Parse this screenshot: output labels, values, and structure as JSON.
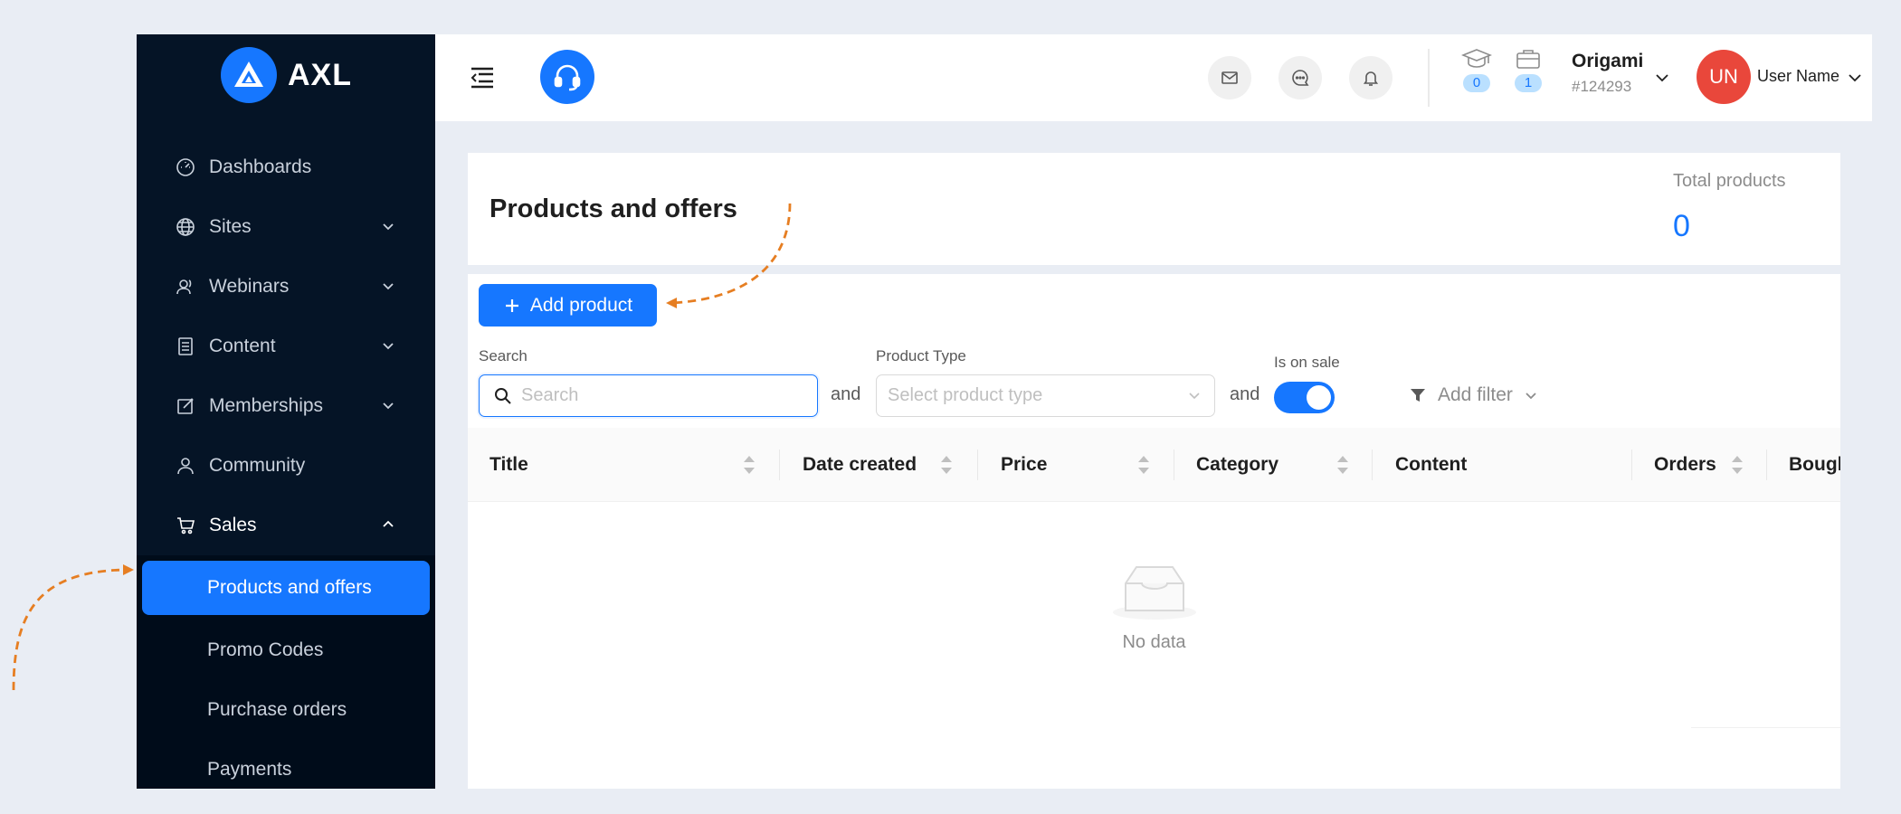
{
  "app": {
    "name": "AXL"
  },
  "sidebar": {
    "items": [
      {
        "label": "Dashboards",
        "icon": "dashboard-icon"
      },
      {
        "label": "Sites",
        "icon": "globe-icon"
      },
      {
        "label": "Webinars",
        "icon": "webinar-icon"
      },
      {
        "label": "Content",
        "icon": "content-icon"
      },
      {
        "label": "Memberships",
        "icon": "edit-icon"
      },
      {
        "label": "Community",
        "icon": "user-icon"
      },
      {
        "label": "Sales",
        "icon": "cart-icon"
      }
    ],
    "sales_submenu": [
      "Products and offers",
      "Promo Codes",
      "Purchase orders",
      "Payments"
    ]
  },
  "header": {
    "courses_count": "0",
    "jobs_count": "1",
    "account_name": "Origami",
    "account_id": "#124293",
    "avatar_initials": "UN",
    "user_name": "User Name"
  },
  "page": {
    "title": "Products and offers",
    "total_label": "Total products",
    "total_value": "0"
  },
  "toolbar": {
    "add_label": "Add product",
    "search_label": "Search",
    "search_placeholder": "Search",
    "search_value": "",
    "and_1": "and",
    "product_type_label": "Product Type",
    "product_type_placeholder": "Select product type",
    "and_2": "and",
    "on_sale_label": "Is on sale",
    "on_sale_value": true,
    "add_filter_label": "Add filter"
  },
  "table": {
    "columns": [
      "Title",
      "Date created",
      "Price",
      "Category",
      "Content",
      "Orders",
      "Bought"
    ],
    "empty_text": "No data"
  },
  "colors": {
    "accent": "#1677ff",
    "sidebar": "#051426",
    "avatar": "#e9473b",
    "annotation": "#e67e22"
  }
}
